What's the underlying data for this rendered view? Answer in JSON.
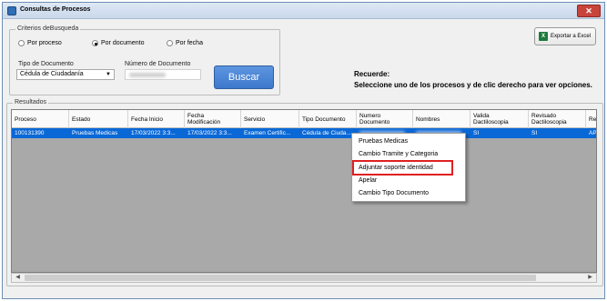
{
  "window": {
    "title": "Consultas de Procesos",
    "close_label": "✕"
  },
  "criteria": {
    "group_label": "Criterios deBusqueda",
    "radios": [
      {
        "label": "Por proceso",
        "checked": false
      },
      {
        "label": "Por documento",
        "checked": true
      },
      {
        "label": "Por fecha",
        "checked": false
      }
    ],
    "doc_type_label": "Tipo de Documento",
    "doc_type_value": "Cédula de Ciudadanía",
    "doc_number_label": "Número de Documento",
    "search_button": "Buscar"
  },
  "excel_button": "Exportar a Excel",
  "note": {
    "line1": "Recuerde:",
    "line2": "Seleccione uno de los procesos y de clic derecho para ver opciones."
  },
  "results": {
    "group_label": "Resultados",
    "columns": [
      "Proceso",
      "Estado",
      "Fecha Inicio",
      "Fecha Modificación",
      "Servicio",
      "Tipo Documento",
      "Numero Documento",
      "Nombres",
      "Valida Dactiloscopia",
      "Revisado Dactiloscopia",
      "Re"
    ],
    "row": [
      "100131390",
      "Pruebas Medicas",
      "17/03/2022 3:3...",
      "17/03/2022 3:3...",
      "Examen Certific...",
      "Cédula de Ciuda...",
      "",
      "",
      "SI",
      "SI",
      "AP"
    ]
  },
  "context_menu": {
    "items": [
      "Pruebas Medicas",
      "Cambio Tramite y Categoria",
      "Adjuntar soporte identidad",
      "Apelar",
      "Cambio Tipo Documento"
    ],
    "highlighted_index": 2
  },
  "colors": {
    "selection": "#0a68d6",
    "highlight": "#e02020",
    "button": "#3c78cc"
  }
}
